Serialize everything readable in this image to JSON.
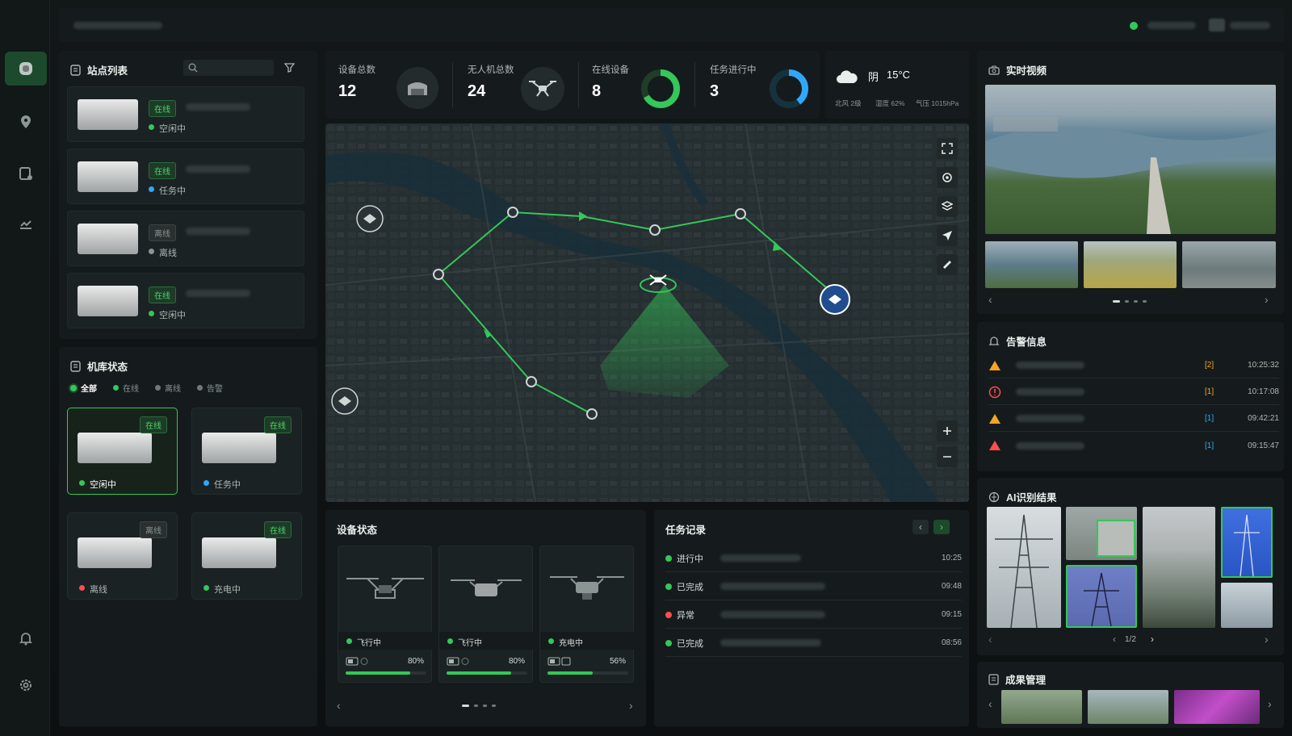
{
  "stations": {
    "title": "站点列表",
    "items": [
      {
        "badge": "在线",
        "status": "空闲中",
        "color": "#34c759"
      },
      {
        "badge": "在线",
        "status": "任务中",
        "color": "#2ea8ff"
      },
      {
        "badge": "离线",
        "status": "离线",
        "color": "#8b9593"
      },
      {
        "badge": "在线",
        "status": "空闲中",
        "color": "#34c759"
      }
    ]
  },
  "hangar": {
    "title": "机库状态",
    "filters": [
      "全部",
      "在线",
      "离线",
      "告警"
    ],
    "items": [
      {
        "badge": "在线",
        "status": "空闲中",
        "color": "#34c759"
      },
      {
        "badge": "在线",
        "status": "任务中",
        "color": "#2ea8ff"
      },
      {
        "badge": "离线",
        "status": "离线",
        "color": "#ff4d4f"
      },
      {
        "badge": "在线",
        "status": "充电中",
        "color": "#34c759"
      }
    ]
  },
  "stats": {
    "total_devices": {
      "label": "设备总数",
      "value": "12"
    },
    "total_drones": {
      "label": "无人机总数",
      "value": "24"
    },
    "online_devices": {
      "label": "在线设备",
      "value": "8",
      "fraction": 0.67
    },
    "tasks_running": {
      "label": "任务进行中",
      "value": "3",
      "fraction": 0.4
    }
  },
  "weather": {
    "condition": "阴",
    "temp": "15°C",
    "wind": "北风 2级",
    "humidity": "湿度 62%",
    "pressure": "气压 1015hPa"
  },
  "device_status": {
    "title": "设备状态",
    "cards": [
      {
        "status": "飞行中",
        "battery": "80%",
        "level": 0.8
      },
      {
        "status": "飞行中",
        "battery": "80%",
        "level": 0.8
      },
      {
        "status": "充电中",
        "battery": "56%",
        "level": 0.56
      }
    ]
  },
  "tasks": {
    "title": "任务记录",
    "rows": [
      {
        "status": "进行中",
        "time": "10:25"
      },
      {
        "status": "已完成",
        "time": "09:48"
      },
      {
        "status": "异常",
        "time": "09:15"
      },
      {
        "status": "已完成",
        "time": "08:56"
      }
    ]
  },
  "video": {
    "title": "实时视频"
  },
  "alarms": {
    "title": "告警信息",
    "rows": [
      {
        "level": "[2]",
        "time": "10:25:32",
        "level_color": "#f5a524"
      },
      {
        "level": "[1]",
        "time": "10:17:08",
        "level_color": "#f5a524"
      },
      {
        "level": "[1]",
        "time": "09:42:21",
        "level_color": "#2ea8ff"
      },
      {
        "level": "[1]",
        "time": "09:15:47",
        "level_color": "#2ea8ff"
      }
    ]
  },
  "ai": {
    "title": "AI识别结果",
    "page": "1/2"
  },
  "results": {
    "title": "成果管理"
  },
  "colors": {
    "accent": "#34c759",
    "blue": "#2ea8ff",
    "warn": "#f5a524",
    "danger": "#ff4d4f"
  }
}
